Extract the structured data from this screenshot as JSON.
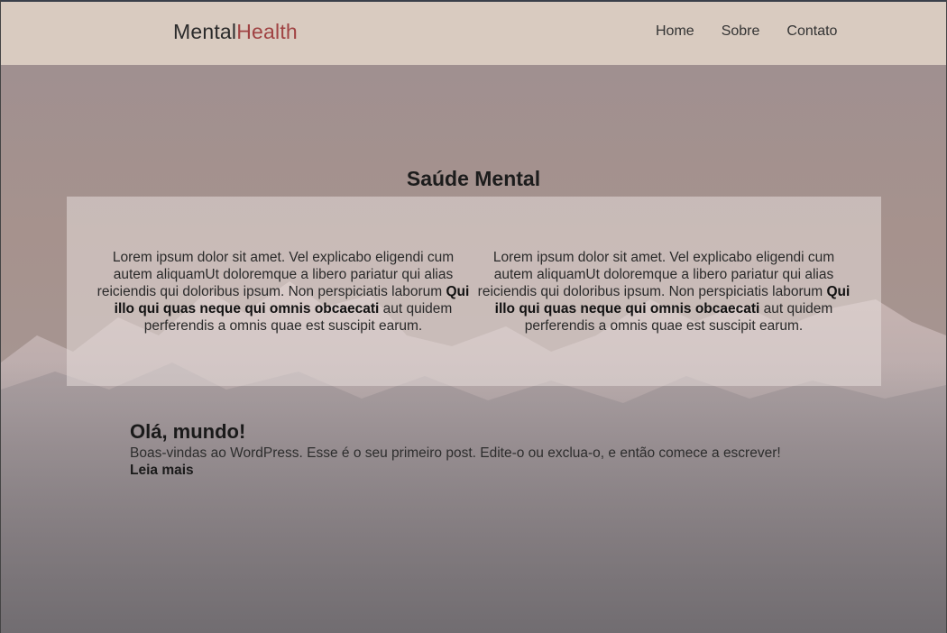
{
  "header": {
    "logo_primary": "Mental",
    "logo_accent": "Health",
    "nav": [
      "Home",
      "Sobre",
      "Contato"
    ]
  },
  "hero": {
    "title": "Saúde Mental",
    "columns": [
      {
        "text": "Lorem ipsum dolor sit amet. Vel explicabo eligendi cum autem aliquamUt doloremque a libero pariatur qui alias reiciendis qui doloribus ipsum. Non perspiciatis laborum",
        "bold": "Qui illo qui quas neque qui omnis obcaecati",
        "tail": "aut quidem perferendis a omnis quae est suscipit earum."
      },
      {
        "text": "Lorem ipsum dolor sit amet. Vel explicabo eligendi cum autem aliquamUt doloremque a libero pariatur qui alias reiciendis qui doloribus ipsum. Non perspiciatis laborum",
        "bold": "Qui illo qui quas neque qui omnis obcaecati",
        "tail": "aut quidem perferendis a omnis quae est suscipit earum."
      }
    ]
  },
  "post": {
    "title": "Olá, mundo!",
    "excerpt": "Boas-vindas ao WordPress. Esse é o seu primeiro post. Edite-o ou exclua-o, e então comece a escrever!",
    "read_more": "Leia mais"
  },
  "colors": {
    "header_bg": "#d9cbc0",
    "logo_accent": "#a04343",
    "text_dark": "#1c1c1c"
  }
}
